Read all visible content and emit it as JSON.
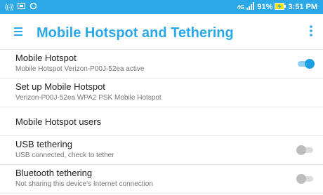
{
  "statusbar": {
    "battery": "91%",
    "time": "3:51 PM",
    "icons": [
      "hotspot-icon",
      "screenshot-icon",
      "sync-icon",
      "network-icon",
      "signal-icon",
      "battery-charging-icon"
    ]
  },
  "appbar": {
    "title": "Mobile Hotspot and Tethering",
    "accent_color": "#2aa8e8"
  },
  "settings": [
    {
      "title": "Mobile Hotspot",
      "subtitle": "Mobile Hotspot Verizon-P00J-52ea active",
      "toggle": true
    },
    {
      "title": "Set up Mobile Hotspot",
      "subtitle": "Verizon-P00J-52ea WPA2 PSK Mobile Hotspot"
    },
    {
      "title": "Mobile Hotspot users"
    },
    {
      "title": "USB tethering",
      "subtitle": "USB connected, check to tether",
      "toggle": false
    },
    {
      "title": "Bluetooth tethering",
      "subtitle": "Not sharing this device's Internet connection",
      "toggle": false
    }
  ]
}
